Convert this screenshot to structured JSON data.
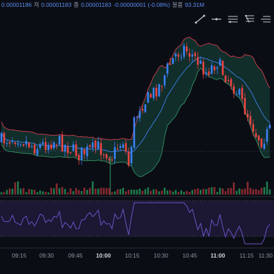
{
  "ohlc": {
    "high_value": "0.00001186",
    "low_label": "저",
    "low_value": "0.00001183",
    "close_label": "종",
    "close_value": "0.00001183",
    "change": "-0.00000001 (-0.08%)",
    "volume_label": "볼륨",
    "volume_value": "93.31M"
  },
  "toolbar": {
    "items": [
      {
        "name": "trendline-tool-icon"
      },
      {
        "name": "horizontal-line-tool-icon"
      },
      {
        "name": "parallel-channel-tool-icon"
      },
      {
        "name": "fib-tool-icon"
      },
      {
        "name": "pitchfork-tool-icon"
      }
    ]
  },
  "colors": {
    "up": "#3b82f6",
    "down": "#ef4444",
    "band_upper": "#c23b4a",
    "band_lower": "#2e8a5e",
    "band_mid": "#3a7ad8",
    "band_fill": "#143a33",
    "rsi": "#6b55c9",
    "rsi_fill": "#1c1733",
    "vol_up": "#1f7a4d",
    "vol_down": "#8a2a30"
  },
  "x_axis": {
    "labels": [
      {
        "text": "09:15",
        "bold": false
      },
      {
        "text": "09:30",
        "bold": false
      },
      {
        "text": "09:45",
        "bold": false
      },
      {
        "text": "10:00",
        "bold": true
      },
      {
        "text": "10:15",
        "bold": false
      },
      {
        "text": "10:30",
        "bold": false
      },
      {
        "text": "10:45",
        "bold": false
      },
      {
        "text": "11:00",
        "bold": true
      },
      {
        "text": "11:15",
        "bold": false
      },
      {
        "text": "11:30",
        "bold": false
      }
    ]
  }
}
